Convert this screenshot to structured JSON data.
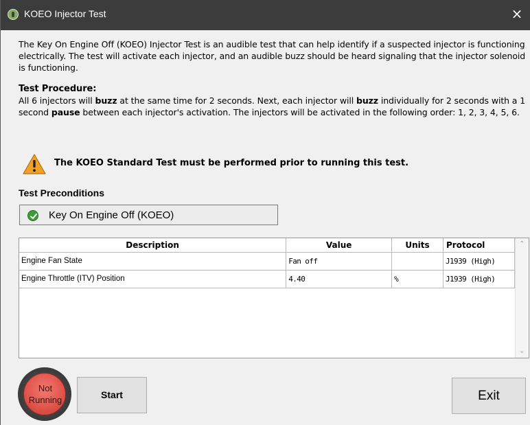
{
  "window": {
    "title": "KOEO Injector Test",
    "close_glyph": "×"
  },
  "intro_text": "The Key On Engine Off (KOEO) Injector Test is an audible test that can help identify if a suspected injector is functioning electrically. The test will activate each injector, and an audible buzz should be heard signaling that the injector solenoid is functioning.",
  "procedure": {
    "heading": "Test Procedure:",
    "part1": "All 6 injectors will ",
    "bold1": "buzz",
    "part2": " at the same time for 2 seconds. Next, each injector will ",
    "bold2": "buzz",
    "part3": " individually for 2 seconds with a 1 second ",
    "bold3": "pause",
    "part4": " between each injector's activation. The injectors will be activated in the following order: 1, 2, 3, 4, 5, 6."
  },
  "warning": {
    "icon": "warning-triangle-icon",
    "text": "The KOEO Standard Test must be performed prior to running this test."
  },
  "preconditions": {
    "heading": "Test Preconditions",
    "items": [
      {
        "label": "Key On Engine Off (KOEO)",
        "icon": "check-circle-icon",
        "status_color": "#3e9b3a"
      }
    ]
  },
  "table": {
    "columns": [
      "Description",
      "Value",
      "Units",
      "Protocol"
    ],
    "rows": [
      [
        "Engine Fan State",
        "Fan off",
        "",
        "J1939 (High)"
      ],
      [
        "Engine Throttle (ITV) Position",
        "4.40",
        "%",
        "J1939 (High)"
      ]
    ]
  },
  "status": {
    "text": "Not Running",
    "line1": "Not",
    "line2": "Running",
    "color": "#e2564c"
  },
  "buttons": {
    "start": "Start",
    "exit": "Exit"
  }
}
